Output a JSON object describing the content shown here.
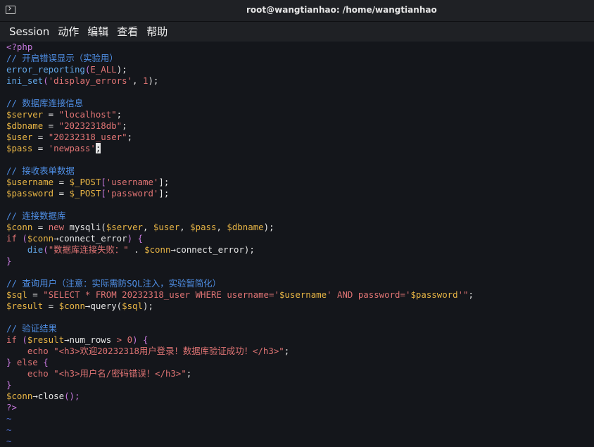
{
  "window": {
    "title": "root@wangtianhao: /home/wangtianhao"
  },
  "menu": {
    "items": [
      "Session",
      "动作",
      "编辑",
      "查看",
      "帮助"
    ]
  },
  "code": {
    "l01": "<?php",
    "l02": "// 开启错误显示（实验用）",
    "l03a": "error_reporting",
    "l03b": "(",
    "l03c": "E_ALL",
    "l03d": ");",
    "l04a": "ini_set",
    "l04b": "(",
    "l04c": "'display_errors'",
    "l04d": ", ",
    "l04e": "1",
    "l04f": ");",
    "l06": "// 数据库连接信息",
    "l07a": "$server",
    "l07b": " = ",
    "l07c": "\"localhost\"",
    "l07d": ";",
    "l08a": "$dbname",
    "l08b": " = ",
    "l08c": "\"20232318db\"",
    "l08d": ";",
    "l09a": "$user",
    "l09b": " = ",
    "l09c": "\"20232318_user\"",
    "l09d": ";",
    "l10a": "$pass",
    "l10b": " = ",
    "l10c": "'newpass'",
    "l10d": ";",
    "l12": "// 接收表单数据",
    "l13a": "$username",
    "l13b": " = ",
    "l13c": "$_POST",
    "l13d": "[",
    "l13e": "'username'",
    "l13f": "];",
    "l14a": "$password",
    "l14b": " = ",
    "l14c": "$_POST",
    "l14d": "[",
    "l14e": "'password'",
    "l14f": "];",
    "l16": "// 连接数据库",
    "l17a": "$conn",
    "l17b": " = ",
    "l17c": "new",
    "l17d": " mysqli(",
    "l17e": "$server",
    "l17f": ", ",
    "l17g": "$user",
    "l17h": ", ",
    "l17i": "$pass",
    "l17j": ", ",
    "l17k": "$dbname",
    "l17l": ");",
    "l18a": "if",
    "l18b": " (",
    "l18c": "$conn",
    "l18d": "→connect_error",
    "l18e": ") {",
    "l19a": "    die",
    "l19b": "(",
    "l19c": "\"数据库连接失败：\"",
    "l19d": " . ",
    "l19e": "$conn",
    "l19f": "→connect_error",
    "l19g": ");",
    "l20": "}",
    "l22": "// 查询用户（注意：实际需防SQL注入，实验暂简化）",
    "l23a": "$sql",
    "l23b": " = ",
    "l23c": "\"SELECT * FROM 20232318_user WHERE username='",
    "l23d": "$username",
    "l23e": "' AND password='",
    "l23f": "$password",
    "l23g": "'\"",
    "l23h": ";",
    "l24a": "$result",
    "l24b": " = ",
    "l24c": "$conn",
    "l24d": "→query(",
    "l24e": "$sql",
    "l24f": ");",
    "l26": "// 验证结果",
    "l27a": "if",
    "l27b": " (",
    "l27c": "$result",
    "l27d": "→num_rows",
    "l27e": " > ",
    "l27f": "0",
    "l27g": ") {",
    "l28a": "    echo",
    "l28b": " \"<h3>欢迎20232318用户登录！数据库验证成功！</h3>\"",
    "l28c": ";",
    "l29a": "}",
    "l29b": " else ",
    "l29c": "{",
    "l30a": "    echo",
    "l30b": " \"<h3>用户名/密码错误！</h3>\"",
    "l30c": ";",
    "l31": "}",
    "l32a": "$conn",
    "l32b": "→close",
    "l32c": "();",
    "l33": "?>",
    "tilde": "~"
  }
}
